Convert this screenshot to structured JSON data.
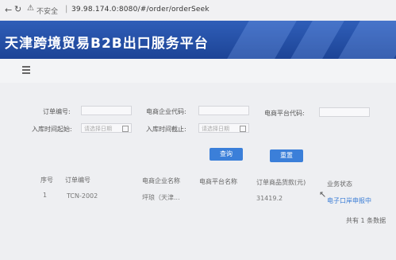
{
  "browser": {
    "security_label": "不安全",
    "url": "39.98.174.0:8080/#/order/orderSeek"
  },
  "banner": {
    "title": "天津跨境贸易B2B出口服务平台"
  },
  "form": {
    "order_no_label": "订单编号:",
    "ecom_code_label": "电商企业代码:",
    "platform_code_label": "电商平台代码:",
    "start_time_label": "入库时间起始:",
    "end_time_label": "入库时间截止:",
    "date_placeholder": "请选择日期",
    "search_button": "查询",
    "reset_button": "重置"
  },
  "table": {
    "headers": [
      "序号",
      "订单编号",
      "电商企业名称",
      "电商平台名称",
      "订单商品货款(元)",
      "业务状态"
    ],
    "rows": [
      {
        "index": "1",
        "order_no": "TCN-2002",
        "ecom_name": "坪琅（天津...",
        "platform_name": "",
        "amount": "31419.2",
        "status": "电子口岸申报中"
      }
    ]
  },
  "footer": {
    "total": "共有 1 条数据"
  }
}
